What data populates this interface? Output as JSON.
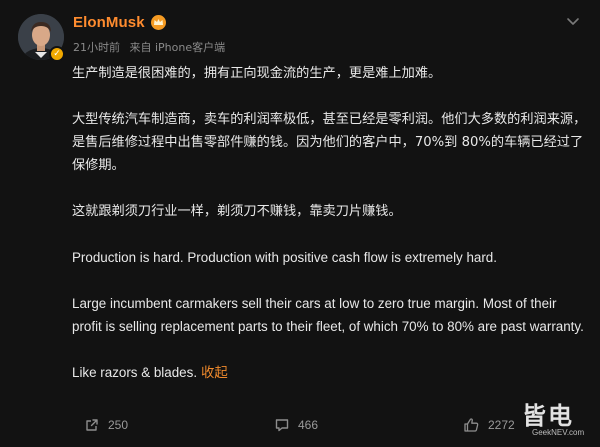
{
  "post": {
    "author": "ElonMusk",
    "time": "21小时前",
    "source": "来自 iPhone客户端",
    "paragraphs": [
      "生产制造是很困难的，拥有正向现金流的生产，更是难上加难。",
      "大型传统汽车制造商，卖车的利润率极低，甚至已经是零利润。他们大多数的利润来源，是售后维修过程中出售零部件赚的钱。因为他们的客户中，70%到 80%的车辆已经过了保修期。",
      "这就跟剃须刀行业一样，剃须刀不赚钱，靠卖刀片赚钱。",
      "Production is hard. Production with positive cash flow is extremely hard.",
      "Large incumbent carmakers sell their cars at low to zero true margin. Most of their profit is selling replacement parts to their fleet, of which 70% to 80% are past warranty.",
      "Like razors & blades."
    ],
    "collapse_label": "收起"
  },
  "actions": {
    "repost_count": "250",
    "comment_count": "466",
    "like_count": "2272"
  },
  "watermark": {
    "text": "皆电",
    "url": "GeekNEV.com"
  },
  "icons": {
    "verified": "verified-badge-icon",
    "vip": "crown-vip-icon",
    "menu": "chevron-down-icon",
    "repost": "repost-icon",
    "comment": "comment-icon",
    "like": "thumbs-up-icon"
  },
  "colors": {
    "background": "#121212",
    "username": "#ff8c2f",
    "link": "#f08a2c",
    "text": "#e8e8e8",
    "meta": "#8a8a8a",
    "verified": "#f2a900"
  }
}
